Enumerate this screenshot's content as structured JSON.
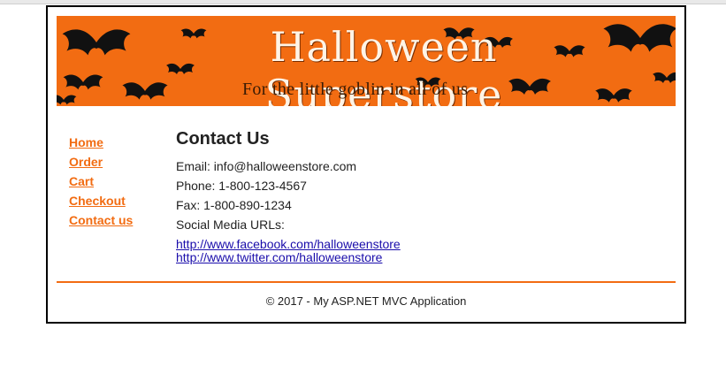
{
  "banner": {
    "title": "Halloween Superstore",
    "subtitle": "For the little goblin in all of us",
    "color": "#f26c12"
  },
  "nav": {
    "items": [
      "Home",
      "Order",
      "Cart",
      "Checkout",
      "Contact us"
    ],
    "link_color": "#f26c12"
  },
  "main": {
    "heading": "Contact Us",
    "email": "Email: info@halloweenstore.com",
    "phone": "Phone: 1-800-123-4567",
    "fax": "Fax: 1-800-890-1234",
    "social_label": "Social Media URLs:",
    "social_links": [
      "http://www.facebook.com/halloweenstore",
      "http://www.twitter.com/halloweenstore"
    ]
  },
  "footer": {
    "text": "© 2017 - My ASP.NET MVC Application"
  }
}
